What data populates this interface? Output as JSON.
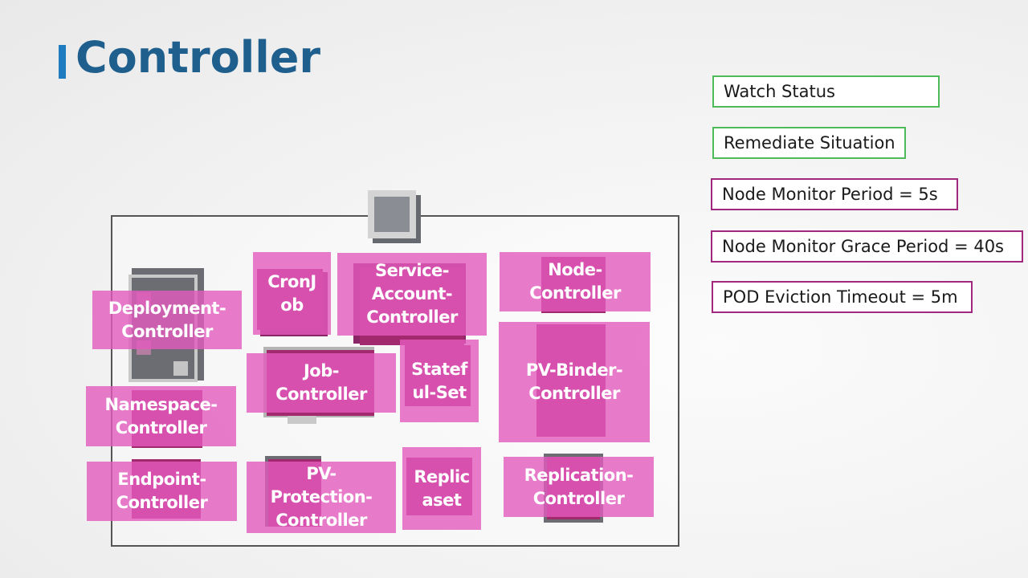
{
  "title": "Controller",
  "colors": {
    "title": "#1e5f8e",
    "accent_bar": "#1f7bbf",
    "green_border": "#4fba58",
    "purple_border": "#a1277f",
    "controller_fill": "#e45abe"
  },
  "side_labels": [
    {
      "text": "Watch Status",
      "style": "green"
    },
    {
      "text": "Remediate Situation",
      "style": "green"
    },
    {
      "text": "Node Monitor Period = 5s",
      "style": "purple"
    },
    {
      "text": "Node Monitor Grace Period = 40s",
      "style": "purple"
    },
    {
      "text": "POD Eviction Timeout = 5m",
      "style": "purple"
    }
  ],
  "diagram": {
    "master_icon": "server-icon",
    "controllers": [
      {
        "name": "Deployment-\nController"
      },
      {
        "name": "CronJ\nob"
      },
      {
        "name": "Service-\nAccount-\nController"
      },
      {
        "name": "Node-\nController"
      },
      {
        "name": "Job-\nController"
      },
      {
        "name": "Statef\nul-Set"
      },
      {
        "name": "PV-Binder-\nController"
      },
      {
        "name": "Namespace-\nController"
      },
      {
        "name": "Endpoint-\nController"
      },
      {
        "name": "PV-\nProtection-\nController"
      },
      {
        "name": "Replic\naset"
      },
      {
        "name": "Replication-\nController"
      }
    ]
  }
}
